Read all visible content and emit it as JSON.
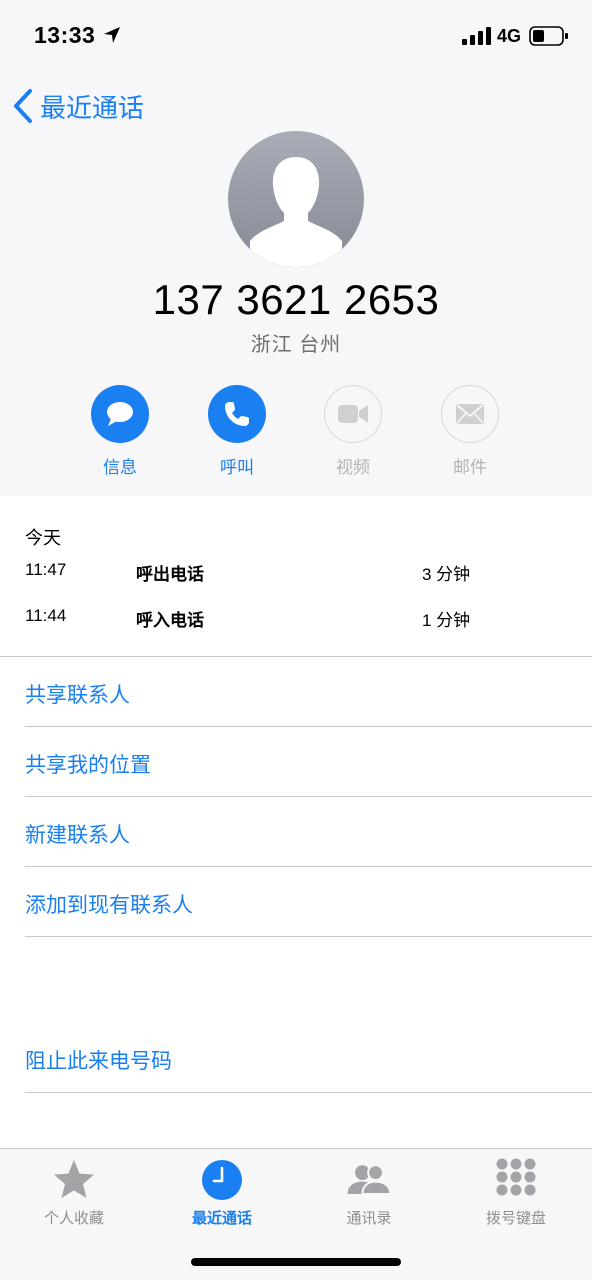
{
  "status_bar": {
    "time": "13:33",
    "network": "4G"
  },
  "nav": {
    "back_label": "最近通话"
  },
  "contact": {
    "number": "137 3621 2653",
    "location": "浙江 台州"
  },
  "actions": [
    {
      "label": "信息",
      "icon": "message-icon",
      "enabled": true
    },
    {
      "label": "呼叫",
      "icon": "phone-icon",
      "enabled": true
    },
    {
      "label": "视频",
      "icon": "video-icon",
      "enabled": false
    },
    {
      "label": "邮件",
      "icon": "mail-icon",
      "enabled": false
    }
  ],
  "recent_calls": {
    "section_title": "今天",
    "rows": [
      {
        "time": "11:47",
        "type": "呼出电话",
        "duration": "3 分钟"
      },
      {
        "time": "11:44",
        "type": "呼入电话",
        "duration": "1 分钟"
      }
    ]
  },
  "menu": {
    "share_contact": "共享联系人",
    "share_location": "共享我的位置",
    "new_contact": "新建联系人",
    "add_to_existing": "添加到现有联系人",
    "block_caller": "阻止此来电号码"
  },
  "tabs": [
    {
      "label": "个人收藏",
      "icon": "star-icon",
      "active": false
    },
    {
      "label": "最近通话",
      "icon": "clock-icon",
      "active": true
    },
    {
      "label": "通讯录",
      "icon": "contacts-icon",
      "active": false
    },
    {
      "label": "拨号键盘",
      "icon": "keypad-icon",
      "active": false
    }
  ],
  "colors": {
    "accent": "#1a7ff0",
    "secondary_text": "#6d6d72",
    "disabled": "#b3b3b7"
  }
}
